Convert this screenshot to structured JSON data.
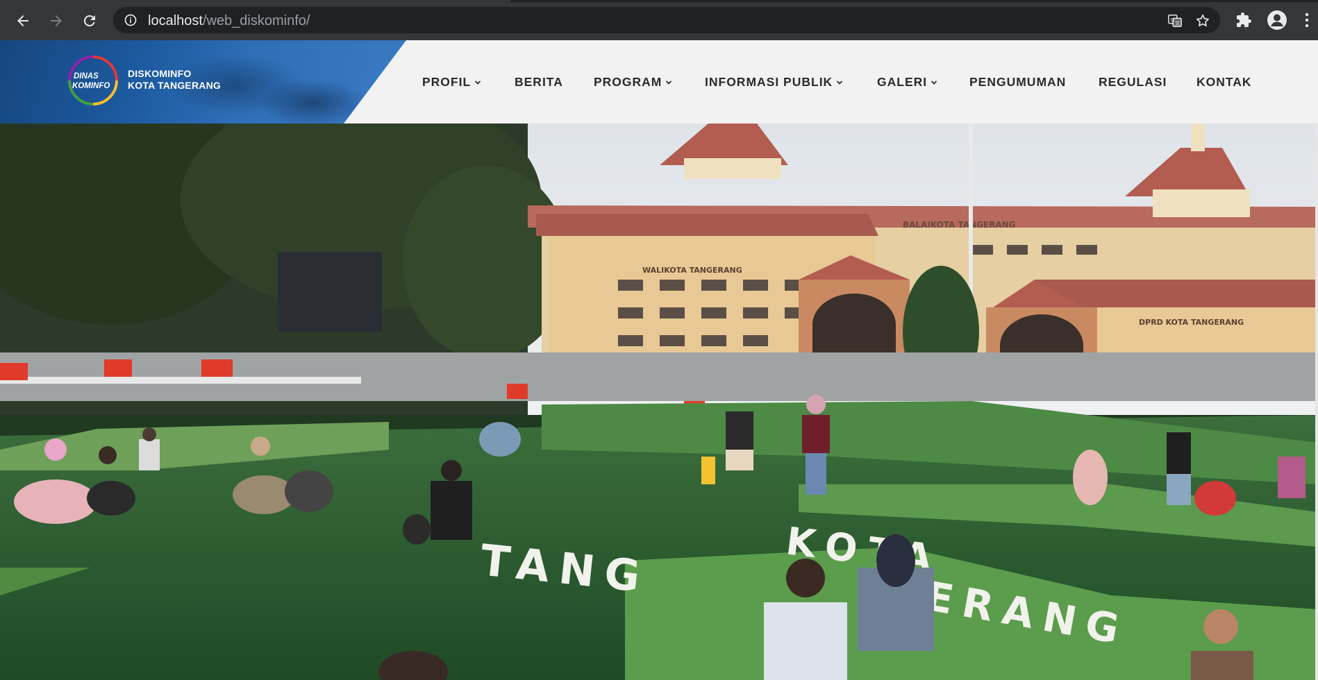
{
  "browser": {
    "url_host": "localhost",
    "url_path": "/web_diskominfo/",
    "icons": [
      "back-arrow-icon",
      "forward-arrow-icon",
      "reload-icon",
      "info-icon",
      "translate-icon",
      "star-icon",
      "extensions-puzzle-icon",
      "profile-avatar-icon",
      "more-vertical-icon"
    ]
  },
  "header": {
    "logo_text": [
      "DINAS",
      "KOMINFO"
    ],
    "brand_line1": "DISKOMINFO",
    "brand_line2": "KOTA TANGERANG",
    "menu": [
      {
        "label": "PROFIL",
        "dropdown": true
      },
      {
        "label": "BERITA",
        "dropdown": false
      },
      {
        "label": "PROGRAM",
        "dropdown": true
      },
      {
        "label": "INFORMASI PUBLIK",
        "dropdown": true
      },
      {
        "label": "GALERI",
        "dropdown": true
      },
      {
        "label": "PENGUMUMAN",
        "dropdown": false
      },
      {
        "label": "REGULASI",
        "dropdown": false
      },
      {
        "label": "KONTAK",
        "dropdown": false
      }
    ]
  },
  "hero": {
    "signs": {
      "balaikota": "BALAIKOTA TANGERANG",
      "walikota": "WALIKOTA TANGERANG",
      "dprd": "DPRD KOTA TANGERANG",
      "lawn_top": "KOTA",
      "lawn_left": "TANG",
      "lawn_right": "ERANG"
    }
  },
  "colors": {
    "chrome_bg": "#35363a",
    "omnibox_bg": "#202124",
    "brand_blue": "#1d5aa0",
    "header_bg": "#f2f2f2",
    "menu_text": "#2a2a2a"
  }
}
